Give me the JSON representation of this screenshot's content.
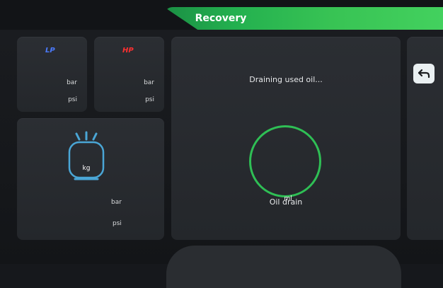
{
  "header": {
    "title": "Recovery"
  },
  "gauges": {
    "lp": {
      "label": "LP",
      "unit_bar": "bar",
      "unit_psi": "psi"
    },
    "hp": {
      "label": "HP",
      "unit_bar": "bar",
      "unit_psi": "psi"
    }
  },
  "tank": {
    "weight_unit": "kg",
    "unit_bar": "bar",
    "unit_psi": "psi"
  },
  "main": {
    "status": "Draining used oil...",
    "ring_unit": "ml",
    "ring_label": "Oil drain"
  },
  "icons": {
    "back": "back-arrow-icon",
    "tank": "refrigerant-tank-icon"
  },
  "colors": {
    "accent": "#2fbf55",
    "lp": "#4b7bff",
    "hp": "#ff3030"
  }
}
